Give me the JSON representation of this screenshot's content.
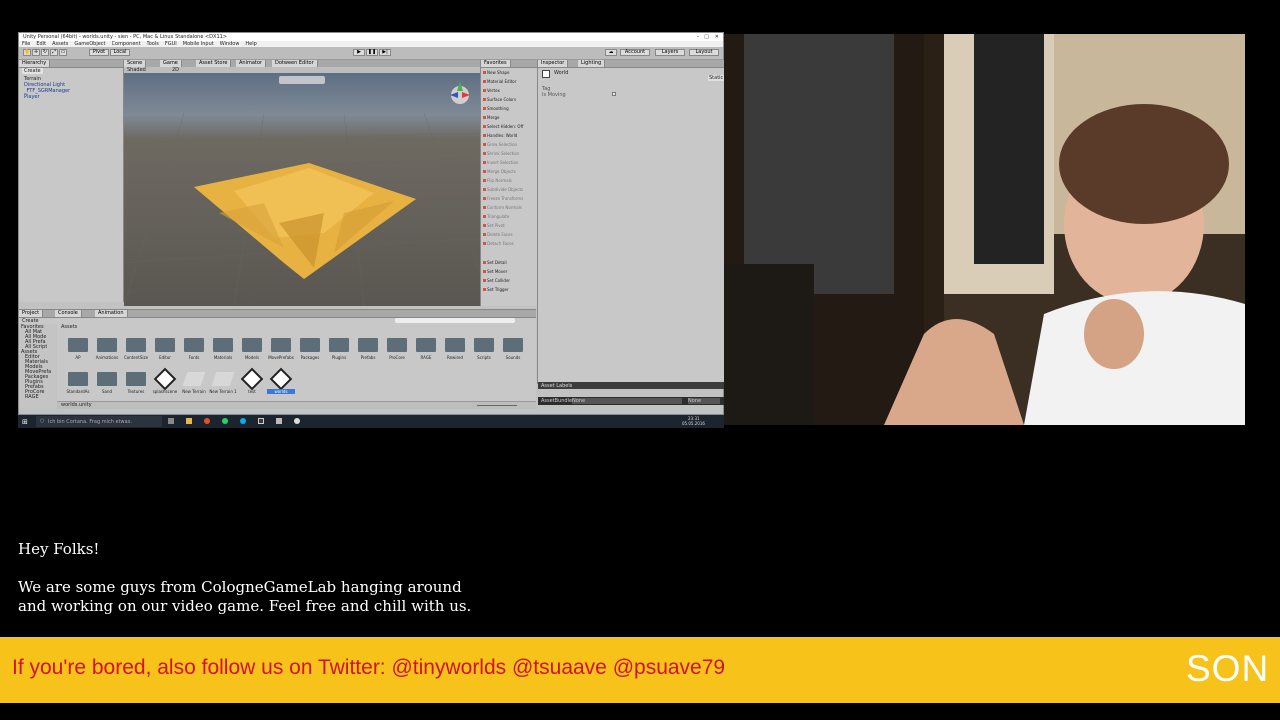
{
  "unity": {
    "title": "Unity Personal (64bit) - worlds.unity - sien - PC, Mac & Linux Standalone <DX11>",
    "menu": [
      "File",
      "Edit",
      "Assets",
      "GameObject",
      "Component",
      "Tools",
      "FGUI",
      "Mobile Input",
      "Window",
      "Help"
    ],
    "toolbar": {
      "pivot": "Pivot",
      "local": "Local",
      "account": "Account",
      "layers": "Layers",
      "layout": "Layout"
    },
    "hierarchy": {
      "tab": "Hierarchy",
      "create": "Create",
      "items": [
        "Terrain",
        "Directional Light",
        "_FTF_SGRManager",
        "Player"
      ]
    },
    "scene": {
      "tabs": [
        "Scene",
        "Game",
        "Asset Store",
        "Animator",
        "Dotween Editor"
      ],
      "shading": "Shaded",
      "mode": "2D"
    },
    "custom_panel": {
      "tab": "Favorites",
      "items": [
        "New Shape",
        "Material Editor",
        "Vertex",
        "Surface Colors",
        "Smoothing",
        "Merge",
        "Select Hidden: Off",
        "Handles: World",
        "Grow Selection",
        "Shrink Selection",
        "Invert Selection",
        "Merge Objects",
        "Flip Normals",
        "Subdivide Objects",
        "Freeze Transforms",
        "Conform Normals",
        "Triangulate",
        "Set Pivot",
        "Delete Faces",
        "Detach Faces",
        "Set Detail",
        "Set Mover",
        "Set Collider",
        "Set Trigger"
      ]
    },
    "inspector": {
      "tab": "Inspector",
      "tab2": "Lighting",
      "name": "World",
      "static": "Static",
      "row1": "Tag",
      "row2": "Is Moving"
    },
    "project": {
      "tabs": [
        "Project",
        "Console",
        "Animation"
      ],
      "create": "Create",
      "breadcrumb": "Assets",
      "tree": [
        "Favorites",
        "All Mat",
        "All Mode",
        "All Prefa",
        "All Script",
        "Assets",
        "Editor",
        "Materials",
        "Models",
        "MovePrefa",
        "Packages",
        "Plugins",
        "Prefabs",
        "ProCore",
        "RAGE"
      ],
      "folders": [
        "AP",
        "Animations",
        "ContentSize",
        "Editor",
        "Fonts",
        "Materials",
        "Models",
        "MovePrefabs",
        "Packages",
        "Plugins",
        "Prefabs",
        "ProCore",
        "RAGE",
        "Rewired",
        "Scripts",
        "Sounds"
      ],
      "row2": [
        "StandardAs",
        "Sand",
        "Textures",
        "splashscene",
        "New Terrain",
        "New Terrain 1",
        "test",
        "worlds"
      ],
      "footer": "worlds.unity",
      "asset_labels": "Asset Labels",
      "assetbundle": "AssetBundle",
      "none1": "None",
      "none2": "None"
    }
  },
  "taskbar": {
    "search": "Ich bin Cortana. Frag mich etwas.",
    "time": "23:31",
    "date": "05.05.2016"
  },
  "overlay": {
    "greeting": "Hey Folks!",
    "line1": "We are some guys from CologneGameLab hanging around",
    "line2": "and working on our video game. Feel free and chill with us."
  },
  "banner": {
    "text": "If you're bored, also follow us on Twitter: @tinyworlds @tsuaave @psuave79",
    "logo": "SON",
    "background": "#f7c31a",
    "text_color": "#d3122a"
  }
}
